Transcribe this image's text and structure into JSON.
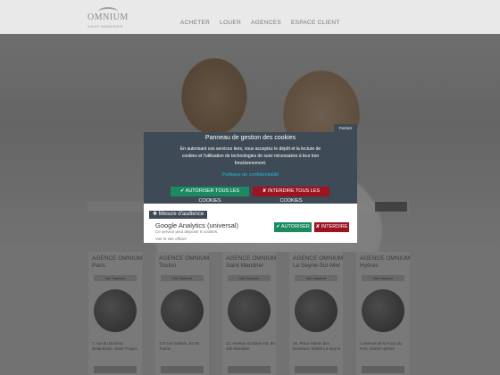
{
  "header": {
    "logo_name": "OMNIUM",
    "logo_tagline": "SAINT MANDRIER",
    "nav": [
      "ACHETER",
      "LOUER",
      "AGENCES",
      "ESPACE CLIENT"
    ]
  },
  "agencies": [
    {
      "name": "AGENCE OMNIUM",
      "city": "Paris",
      "btn": "Voir l'agence",
      "address": "7, rue du Docteur, Delandoine, Saint-Tropez"
    },
    {
      "name": "AGENCE OMNIUM",
      "city": "Toulon",
      "btn": "Voir l'agence",
      "address": "173 rue Gratien, 83 00 Toulon"
    },
    {
      "name": "AGENCE OMNIUM",
      "city": "Saint Mandrier",
      "btn": "Voir l'agence",
      "address": "12, Avenue Gustave Ed, 83 430 Mandrier"
    },
    {
      "name": "AGENCE OMNIUM",
      "city": "La Seyne-Sur-Mer",
      "btn": "Voir l'agence",
      "address": "46, Place Martin des Docteurs, 83500 La Seyne"
    },
    {
      "name": "AGENCE OMNIUM",
      "city": "Hyères",
      "btn": "Voir l'agence",
      "address": "1 avenue de la Foux du Port, 83400 Hyères"
    }
  ],
  "cookie_panel": {
    "close_label": "Fermer",
    "title": "Panneau de gestion des cookies",
    "description": "En autorisant ces services tiers, vous acceptez le dépôt et la lecture de cookies et l'utilisation de technologies de suivi nécessaires à leur bon fonctionnement.",
    "policy_link": "Politique de confidentialité",
    "allow_all": "✔ AUTORISER TOUS LES COOKIES",
    "deny_all": "✘ INTERDIRE TOUS LES COOKIES",
    "category": "✚ Mesure d'audience",
    "service": {
      "name": "Google Analytics (universal)",
      "description": "Ce service peut déposer 8 cookies.",
      "link": "Voir le site officiel",
      "allow": "✔ AUTORISER",
      "deny": "✘ INTERDIRE"
    }
  },
  "colors": {
    "panel_bg": "#3e4a55",
    "allow_green": "#1b8a60",
    "deny_red": "#9c1422",
    "link_cyan": "#1fb6d7"
  }
}
